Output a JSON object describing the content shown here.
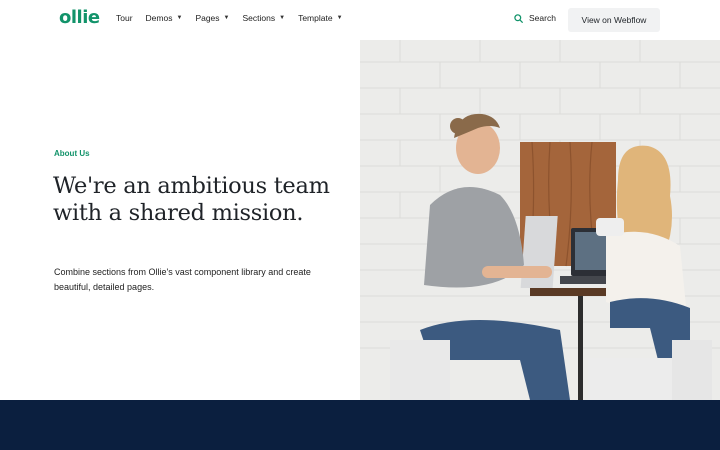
{
  "brand": {
    "logo_text": "ollie",
    "accent": "#12936a"
  },
  "nav": {
    "items": [
      {
        "label": "Tour",
        "has_dropdown": false
      },
      {
        "label": "Demos",
        "has_dropdown": true
      },
      {
        "label": "Pages",
        "has_dropdown": true
      },
      {
        "label": "Sections",
        "has_dropdown": true
      },
      {
        "label": "Template",
        "has_dropdown": true
      }
    ],
    "caret": "▼",
    "search_label": "Search",
    "cta_label": "View on Webflow"
  },
  "hero": {
    "eyebrow": "About Us",
    "headline": "We're an ambitious team with a shared mission.",
    "subtext": "Combine sections from Ollie's vast component library and create beautiful, detailed pages."
  },
  "colors": {
    "footer_band": "#0b1f3f",
    "button_bg": "#f1f2f3"
  }
}
